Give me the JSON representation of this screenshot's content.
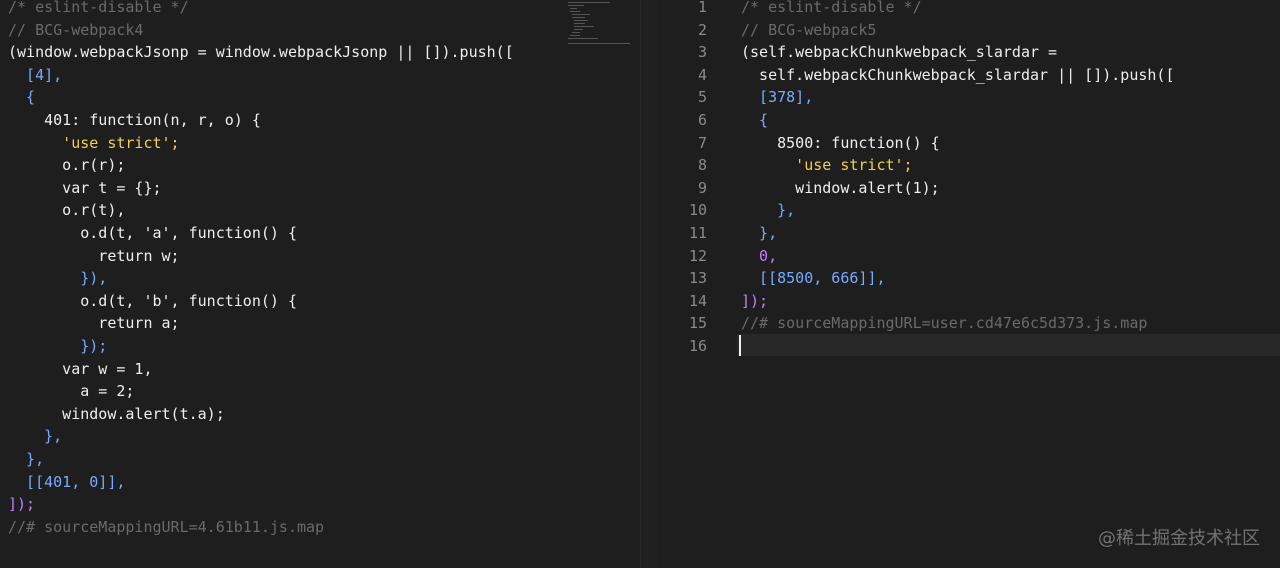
{
  "editor": {
    "left": {
      "lines": [
        "/* eslint-disable */",
        "// BCG-webpack4",
        "(window.webpackJsonp = window.webpackJsonp || []).push([",
        "  [4],",
        "  {",
        "    401: function(n, r, o) {",
        "      'use strict';",
        "      o.r(r);",
        "      var t = {};",
        "      o.r(t),",
        "        o.d(t, 'a', function() {",
        "          return w;",
        "        }),",
        "        o.d(t, 'b', function() {",
        "          return a;",
        "        });",
        "      var w = 1,",
        "        a = 2;",
        "      window.alert(t.a);",
        "    },",
        "  },",
        "  [[401, 0]],",
        "]);",
        "//# sourceMappingURL=4.61b11.js.map"
      ]
    },
    "right": {
      "line_numbers": [
        "1",
        "2",
        "3",
        "4",
        "5",
        "6",
        "7",
        "8",
        "9",
        "10",
        "11",
        "12",
        "13",
        "14",
        "15",
        "16"
      ],
      "lines": [
        "/* eslint-disable */",
        "// BCG-webpack5",
        "(self.webpackChunkwebpack_slardar =",
        "  self.webpackChunkwebpack_slardar || []).push([",
        "  [378],",
        "  {",
        "    8500: function() {",
        "      'use strict';",
        "      window.alert(1);",
        "    },",
        "  },",
        "  0,",
        "  [[8500, 666]],",
        "]);",
        "//# sourceMappingURL=user.cd47e6c5d373.js.map",
        ""
      ]
    },
    "watermark": "@稀土掘金技术社区"
  },
  "colors": {
    "background": "#1e1e1e",
    "comment": "#6a6a6a",
    "keyword": "#5aa6f0",
    "function": "#2fb8ff",
    "string": "#f0d04c",
    "number": "#c77dff",
    "parameter": "#ffb347"
  }
}
